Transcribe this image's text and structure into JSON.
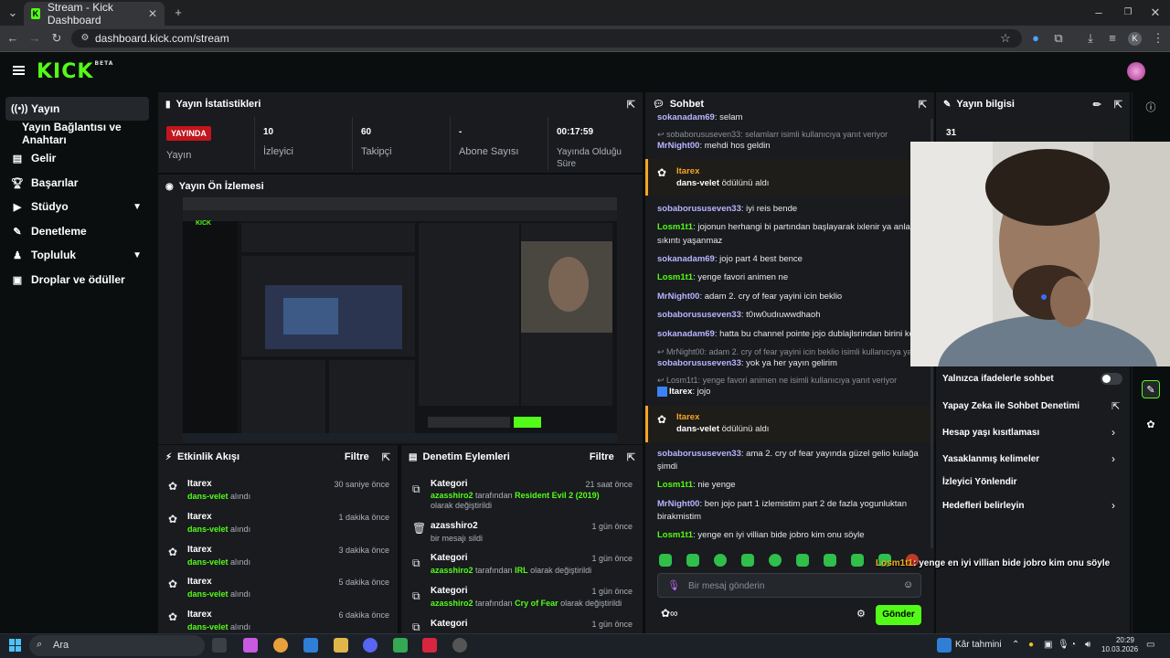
{
  "browser": {
    "tab_title": "Stream - Kick Dashboard",
    "url": "dashboard.kick.com/stream",
    "profile_initial": "K"
  },
  "brand": {
    "logo": "KICK",
    "logo_badge": "BETA",
    "accent": "#53fc18"
  },
  "sidebar": {
    "items": [
      {
        "label": "Yayın",
        "icon": "broadcast-icon"
      },
      {
        "label": "Yayın Bağlantısı ve Anahtarı",
        "icon": ""
      },
      {
        "label": "Gelir",
        "icon": "dollar-icon"
      },
      {
        "label": "Başarılar",
        "icon": "trophy-icon"
      },
      {
        "label": "Stüdyo",
        "icon": "video-icon"
      },
      {
        "label": "Denetleme",
        "icon": "wrench-icon"
      },
      {
        "label": "Topluluk",
        "icon": "users-icon"
      },
      {
        "label": "Droplar ve ödüller",
        "icon": "gift-icon"
      }
    ]
  },
  "stats": {
    "title": "Yayın İstatistikleri",
    "live_badge": "YAYINDA",
    "live_label": "Yayın",
    "viewers_value": "10",
    "viewers_label": "İzleyici",
    "followers_value": "60",
    "followers_label": "Takipçi",
    "subs_value": "-",
    "subs_label": "Abone Sayısı",
    "duration_value": "00:17:59",
    "duration_label": "Yayında Olduğu Süre"
  },
  "preview": {
    "title": "Yayın Ön İzlemesi"
  },
  "activity": {
    "title": "Etkinlik Akışı",
    "filter": "Filtre",
    "rows": [
      {
        "user": "Itarex",
        "item": "dans-velet",
        "suffix": "alındı",
        "time": "30 saniye önce"
      },
      {
        "user": "Itarex",
        "item": "dans-velet",
        "suffix": "alındı",
        "time": "1 dakika önce"
      },
      {
        "user": "Itarex",
        "item": "dans-velet",
        "suffix": "alındı",
        "time": "3 dakika önce"
      },
      {
        "user": "Itarex",
        "item": "dans-velet",
        "suffix": "alındı",
        "time": "5 dakika önce"
      },
      {
        "user": "Itarex",
        "item": "dans-velet",
        "suffix": "alındı",
        "time": "6 dakika önce"
      }
    ]
  },
  "moderation": {
    "title": "Denetim Eylemleri",
    "filter": "Filtre",
    "rows": [
      {
        "title": "Kategori",
        "user": "azasshiro2",
        "mid": "tarafından",
        "value": "Resident Evil 2 (2019)",
        "end": "olarak değiştirildi",
        "time": "21 saat önce"
      },
      {
        "title": "azasshiro2",
        "sub": "bir mesajı sildi",
        "time": "1 gün önce"
      },
      {
        "title": "Kategori",
        "user": "azasshiro2",
        "mid": "tarafından",
        "value": "IRL",
        "end": "olarak değiştirildi",
        "time": "1 gün önce"
      },
      {
        "title": "Kategori",
        "user": "azasshiro2",
        "mid": "tarafından",
        "value": "Cry of Fear",
        "end": "olarak değiştirildi",
        "time": "1 gün önce"
      },
      {
        "title": "Kategori",
        "time": "1 gün önce"
      }
    ]
  },
  "chat": {
    "title": "Sohbet",
    "messages": [
      {
        "user": "sokanadam69",
        "text": "selam"
      },
      {
        "reply": "sobaborususeven33: selamlarr isimli kullanıcıya yanıt veriyor"
      },
      {
        "user": "MrNight00",
        "text": "mehdi hos geldin"
      },
      {
        "award_user": "Itarex",
        "award_item": "dans-velet",
        "award_suffix": "ödülünü aldı"
      },
      {
        "user": "sobaborususeven33",
        "text": "iyi reis bende"
      },
      {
        "user": "Losm1t1",
        "text": "jojonun herhangi bi partından başlayarak ixlenir ya anlamadığın"
      },
      {
        "cont": "sıkıntı yaşanmaz"
      },
      {
        "user": "sokanadam69",
        "text": "jojo part 4 best bence"
      },
      {
        "user": "Losm1t1",
        "text": "yenge favori animen ne"
      },
      {
        "user": "MrNight00",
        "text": "adam 2. cry of fear yayini icin beklio"
      },
      {
        "user": "sobaborususeven33",
        "text": "t0ıw0udıuwwdhaoh"
      },
      {
        "user": "sokanadam69",
        "text": "hatta bu channel pointe jojo dublajlsrindan birini koum"
      },
      {
        "reply": "MrNight00: adam 2. cry of fear yayini icin beklio isimli kullanıcıya yanıt"
      },
      {
        "user": "sobaborususeven33",
        "text": "yok ya her yayın gelirim"
      },
      {
        "reply": "Losm1t1: yenge favori animen ne isimli kullanıcıya yanıt veriyor"
      },
      {
        "user": "Itarex",
        "text": "jojo"
      },
      {
        "award_user": "Itarex",
        "award_item": "dans-velet",
        "award_suffix": "ödülünü aldı"
      },
      {
        "user": "sobaborususeven33",
        "text": "ama 2. cry of fear yayında güzel gelio kulağa"
      },
      {
        "cont": "şimdi"
      },
      {
        "user": "Losm1t1",
        "text": "nie yenge"
      },
      {
        "user": "MrNight00",
        "text": "ben jojo part 1 izlemistim part 2 de fazla yogunluktan"
      },
      {
        "cont": "birakmistim"
      },
      {
        "user": "Losm1t1",
        "text": "yenge en iyi villian bide jobro kim onu söyle"
      }
    ],
    "input_placeholder": "Bir mesaj gönderin",
    "send": "Gönder"
  },
  "stream_info": {
    "title": "Yayın bilgisi",
    "value": "31",
    "settings": [
      {
        "label": "Yalnızca ifadelerle sohbet",
        "control": "toggle"
      },
      {
        "label": "Yapay Zeka ile Sohbet Denetimi",
        "control": "external"
      },
      {
        "label": "Hesap yaşı kısıtlaması",
        "control": "arrow"
      },
      {
        "label": "Yasaklanmış kelimeler",
        "control": "arrow"
      },
      {
        "label": "İzleyici Yönlendir",
        "control": ""
      },
      {
        "label": "Hedefleri belirleyin",
        "control": "arrow"
      }
    ]
  },
  "overlay": {
    "user": "Losm1t1",
    "text": ": yenge en iyi villian bide jobro kim onu söyle"
  },
  "taskbar": {
    "search": "Ara",
    "weather": "Kâr tahmini",
    "time": "20:29",
    "date": "10.03.2026"
  }
}
